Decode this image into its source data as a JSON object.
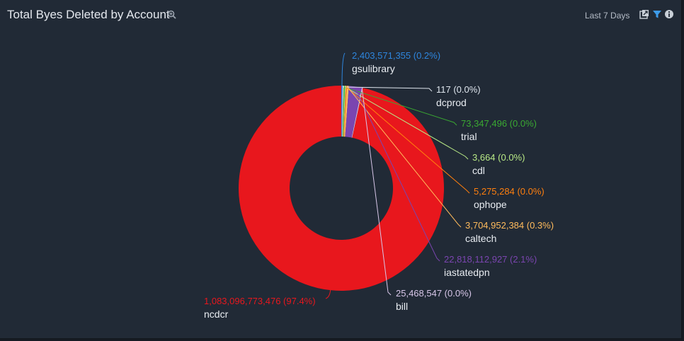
{
  "header": {
    "title": "Total Byes Deleted by Account",
    "range": "Last 7 Days",
    "icons": [
      "zoom-icon",
      "export-icon",
      "filter-icon",
      "info-icon"
    ]
  },
  "colors": {
    "background": "#212a36",
    "text": "#e8ecf1"
  },
  "chart_data": {
    "type": "pie",
    "donut": true,
    "title": "Total Byes Deleted by Account",
    "series": [
      {
        "name": "ncdcr",
        "value": 1083096773476,
        "value_label": "1,083,096,773,476 (97.4%)",
        "percent": 97.4,
        "color": "#e8171d"
      },
      {
        "name": "gsulibrary",
        "value": 2403571355,
        "value_label": "2,403,571,355 (0.2%)",
        "percent": 0.2,
        "color": "#2e86de"
      },
      {
        "name": "dcprod",
        "value": 117,
        "value_label": "117 (0.0%)",
        "percent": 0.0,
        "color": "#dfe6ee"
      },
      {
        "name": "trial",
        "value": 73347496,
        "value_label": "73,347,496 (0.0%)",
        "percent": 0.0,
        "color": "#3aa832"
      },
      {
        "name": "cdl",
        "value": 3664,
        "value_label": "3,664 (0.0%)",
        "percent": 0.0,
        "color": "#b8e986"
      },
      {
        "name": "ophope",
        "value": 5275284,
        "value_label": "5,275,284 (0.0%)",
        "percent": 0.0,
        "color": "#ff7f0e"
      },
      {
        "name": "caltech",
        "value": 3704952384,
        "value_label": "3,704,952,384 (0.3%)",
        "percent": 0.3,
        "color": "#ffbb5c"
      },
      {
        "name": "iastatedpn",
        "value": 22818112927,
        "value_label": "22,818,112,927 (2.1%)",
        "percent": 2.1,
        "color": "#7b45b0"
      },
      {
        "name": "bill",
        "value": 25468547,
        "value_label": "25,468,547 (0.0%)",
        "percent": 0.0,
        "color": "#d7c6e8"
      }
    ]
  }
}
